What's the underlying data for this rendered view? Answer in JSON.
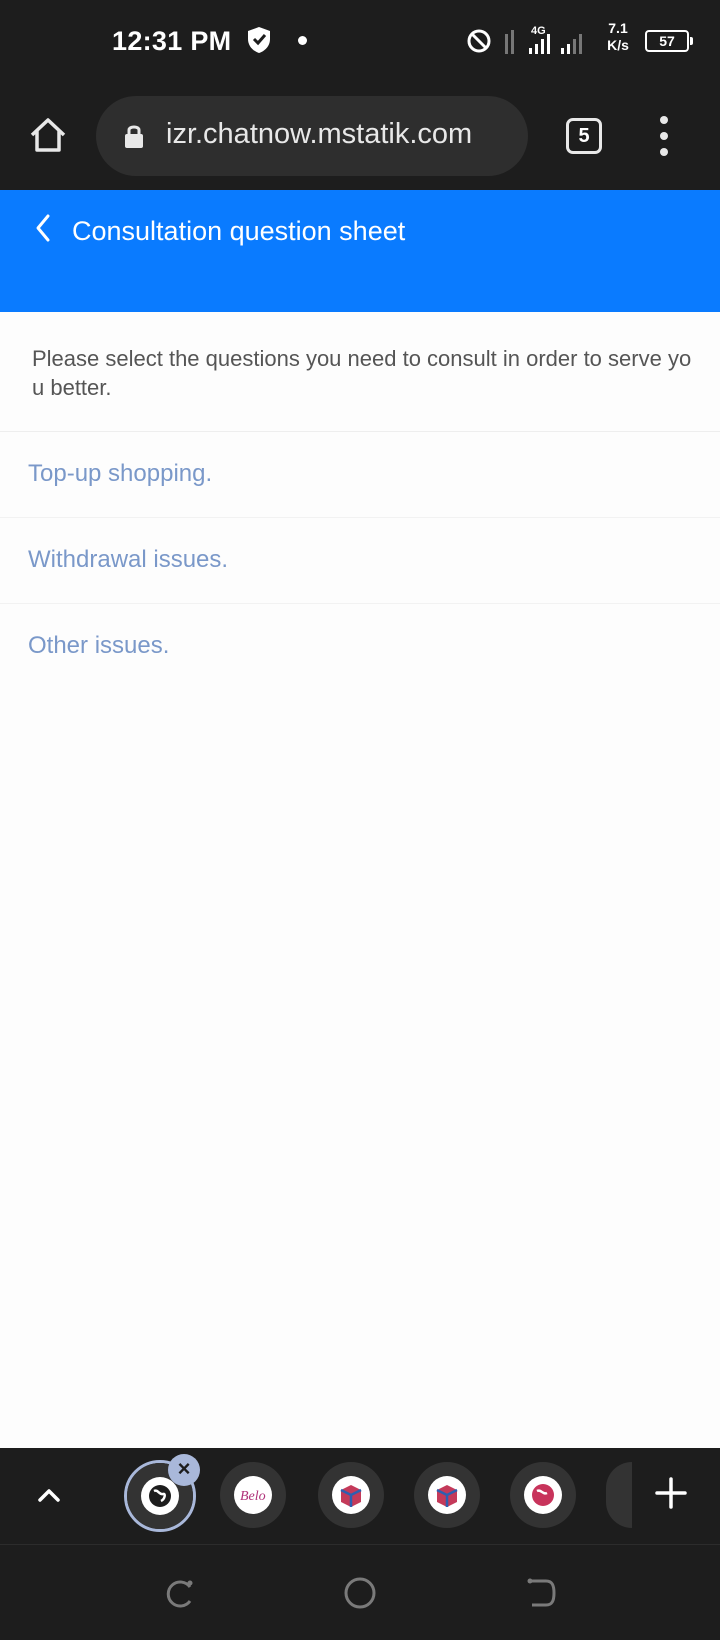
{
  "status_bar": {
    "time": "12:31 PM",
    "network": "4G",
    "speed_value": "7.1",
    "speed_unit": "K/s",
    "battery": "57"
  },
  "browser": {
    "url": "izr.chatnow.mstatik.com",
    "tab_count": "5"
  },
  "header": {
    "title": "Consultation question sheet"
  },
  "intro": "Please select the questions you need to consult in order to serve you better.",
  "questions": [
    "Top-up shopping.",
    "Withdrawal issues.",
    "Other issues."
  ],
  "tab_strip": {
    "thumb_logo_text": "Belo"
  },
  "colors": {
    "header_blue": "#0a7bff",
    "link_blue": "#7a98c9",
    "chrome_dark": "#1d1d1d"
  }
}
